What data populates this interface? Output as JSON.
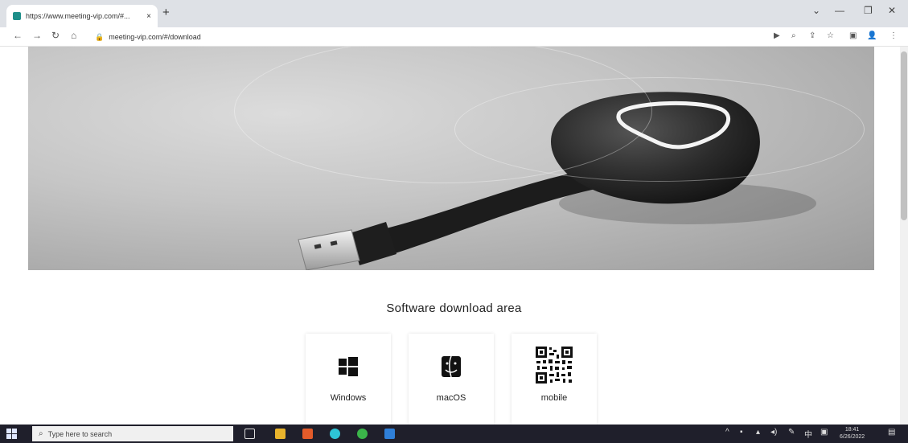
{
  "browser": {
    "tab_title": "https://www.meeting-vip.com/#...",
    "tab_close": "×",
    "new_tab": "+",
    "url": "meeting-vip.com/#/download",
    "window_controls": {
      "minimize": "—",
      "maximize": "❐",
      "close": "✕",
      "dropdown": "⌄"
    }
  },
  "page": {
    "section_title": "Software download area",
    "downloads": [
      {
        "label": "Windows",
        "icon": "windows-icon"
      },
      {
        "label": "macOS",
        "icon": "finder-icon"
      },
      {
        "label": "mobile",
        "icon": "qr-code-icon"
      }
    ]
  },
  "taskbar": {
    "search_placeholder": "Type here to search",
    "time": "18:41",
    "date": "6/26/2022"
  },
  "colors": {
    "tabbar": "#dee1e6",
    "taskbar": "#1f1f2b",
    "accent": "#1e8f8a"
  }
}
